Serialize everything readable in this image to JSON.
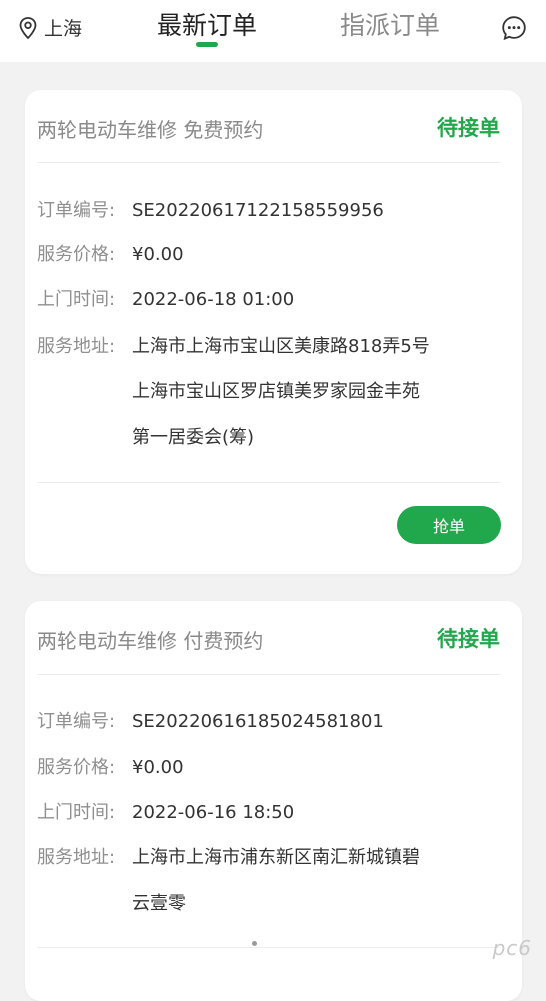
{
  "header": {
    "location": "上海",
    "tabs": [
      {
        "label": "最新订单",
        "active": true
      },
      {
        "label": "指派订单",
        "active": false
      }
    ],
    "accent_color": "#21a84d"
  },
  "orders": [
    {
      "title": "两轮电动车维修  免费预约",
      "status": "待接单",
      "fields": {
        "order_no_label": "订单编号:",
        "order_no": "SE20220617122158559956",
        "price_label": "服务价格:",
        "price": "¥0.00",
        "time_label": "上门时间:",
        "time": "2022-06-18 01:00",
        "address_label": "服务地址:",
        "address_lines": [
          "上海市上海市宝山区美康路818弄5号",
          "上海市宝山区罗店镇美罗家园金丰苑",
          "第一居委会(筹)"
        ]
      },
      "action_label": "抢单"
    },
    {
      "title": "两轮电动车维修  付费预约",
      "status": "待接单",
      "fields": {
        "order_no_label": "订单编号:",
        "order_no": "SE20220616185024581801",
        "price_label": "服务价格:",
        "price": "¥0.00",
        "time_label": "上门时间:",
        "time": "2022-06-16 18:50",
        "address_label": "服务地址:",
        "address_lines": [
          "上海市上海市浦东新区南汇新城镇碧",
          "云壹零"
        ]
      }
    }
  ],
  "watermark": "pc6"
}
